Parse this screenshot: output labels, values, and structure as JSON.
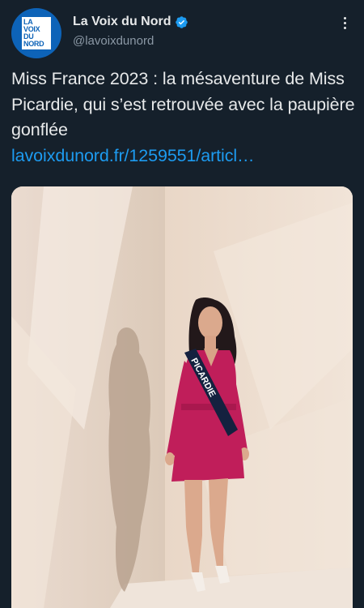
{
  "account": {
    "display_name": "La Voix du Nord",
    "handle": "@lavoixdunord",
    "logo_lines": [
      "LA",
      "VOIX",
      "DU",
      "NORD"
    ],
    "verified": true,
    "verified_icon": "verified-badge-icon",
    "brand_color": "#0d63b8"
  },
  "tweet": {
    "text": "Miss France 2023 : la mésaventure de Miss Picardie, qui s’est retrouvée avec la paupière gonflée",
    "link": "lavoixdunord.fr/1259551/articl…",
    "link_color": "#1d9bf0"
  },
  "media": {
    "sash_text": "PICARDIE",
    "dress_color": "#c01e5a"
  },
  "menu": {
    "icon": "more-options-icon"
  }
}
